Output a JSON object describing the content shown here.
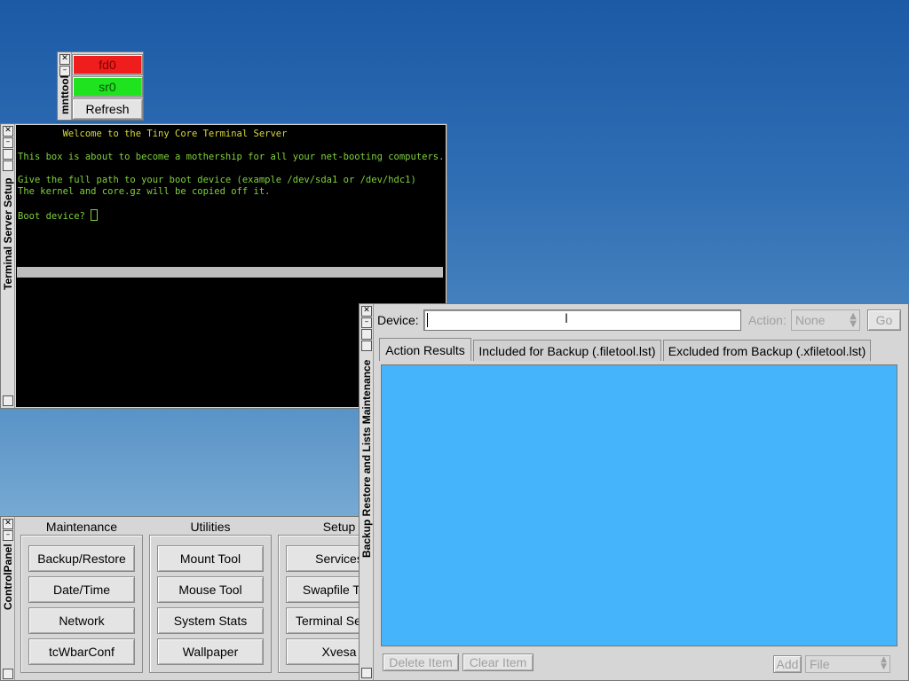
{
  "mnttool": {
    "title": "mnttool",
    "buttons": [
      {
        "label": "fd0",
        "color": "#f01d1d"
      },
      {
        "label": "sr0",
        "color": "#1fe31f"
      },
      {
        "label": "Refresh",
        "color": "#e4e4e4"
      }
    ]
  },
  "terminal": {
    "title": "Terminal Server Setup",
    "lines": [
      "        Welcome to the Tiny Core Terminal Server",
      "",
      "This box is about to become a mothership for all your net-booting computers.",
      "",
      "Give the full path to your boot device (example /dev/sda1 or /dev/hdc1)",
      "The kernel and core.gz will be copied off it.",
      "",
      "Boot device? "
    ],
    "text_color": "#7fd13b",
    "header_color": "#d8d83c"
  },
  "backup": {
    "title": "Backup Restore and Lists Maintenance",
    "device_label": "Device:",
    "device_value": "",
    "action_label": "Action:",
    "action_value": "None",
    "go_label": "Go",
    "tabs": [
      "Action Results",
      "Included for Backup (.filetool.lst)",
      "Excluded from Backup (.xfiletool.lst)"
    ],
    "results_bg": "#45b4fa",
    "delete_label": "Delete Item",
    "clear_label": "Clear Item",
    "add_label": "Add",
    "file_value": "File"
  },
  "controlpanel": {
    "title": "ControlPanel",
    "groups": [
      {
        "label": "Maintenance",
        "items": [
          "Backup/Restore",
          "Date/Time",
          "Network",
          "tcWbarConf"
        ]
      },
      {
        "label": "Utilities",
        "items": [
          "Mount Tool",
          "Mouse Tool",
          "System Stats",
          "Wallpaper"
        ]
      },
      {
        "label": "Setup",
        "items": [
          "Services",
          "Swapfile Tool",
          "Terminal Server",
          "Xvesa"
        ]
      }
    ]
  }
}
